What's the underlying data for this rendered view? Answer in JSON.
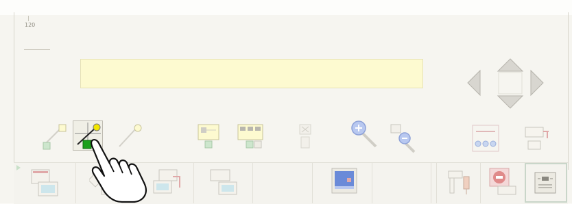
{
  "counter": {
    "value": "120"
  },
  "message_bar": {
    "text": ""
  },
  "colors": {
    "message_bar_bg": "#fdfad0",
    "nav_arrow_fill": "#d8d6d0",
    "nav_arrow_stroke": "#b0aea6",
    "accent_yellow": "#f2e600",
    "accent_green": "#1ca01c",
    "accent_blue": "#6a8ad8"
  },
  "toolbar": {
    "items": [
      {
        "name": "draw-line-tool",
        "icon": "line-draw-icon"
      },
      {
        "name": "draw-line-with-marker-tool",
        "icon": "line-marker-icon"
      },
      {
        "name": "pin-tool",
        "icon": "pin-icon"
      },
      {
        "name": "layout-tool-a",
        "icon": "layout-icon"
      },
      {
        "name": "layout-tool-b",
        "icon": "layout-grid-icon"
      },
      {
        "name": "delete-tool",
        "icon": "delete-icon"
      },
      {
        "name": "zoom-in-tool",
        "icon": "zoom-in-icon"
      },
      {
        "name": "zoom-out-tool",
        "icon": "zoom-out-icon"
      },
      {
        "name": "network-tool",
        "icon": "network-icon"
      },
      {
        "name": "export-tool",
        "icon": "export-icon"
      }
    ]
  },
  "bottom_bar": {
    "items": [
      {
        "name": "window-tool-1",
        "icon": "window-icon"
      },
      {
        "name": "window-tool-2",
        "icon": "window-icon"
      },
      {
        "name": "window-tool-3",
        "icon": "window-icon"
      },
      {
        "name": "window-tool-4",
        "icon": "window-icon"
      },
      {
        "name": "monitor-tool",
        "icon": "monitor-icon"
      },
      {
        "name": "connector-tool",
        "icon": "connector-icon"
      },
      {
        "name": "stop-tool",
        "icon": "stop-icon"
      },
      {
        "name": "panel-tool",
        "icon": "panel-icon"
      }
    ]
  }
}
